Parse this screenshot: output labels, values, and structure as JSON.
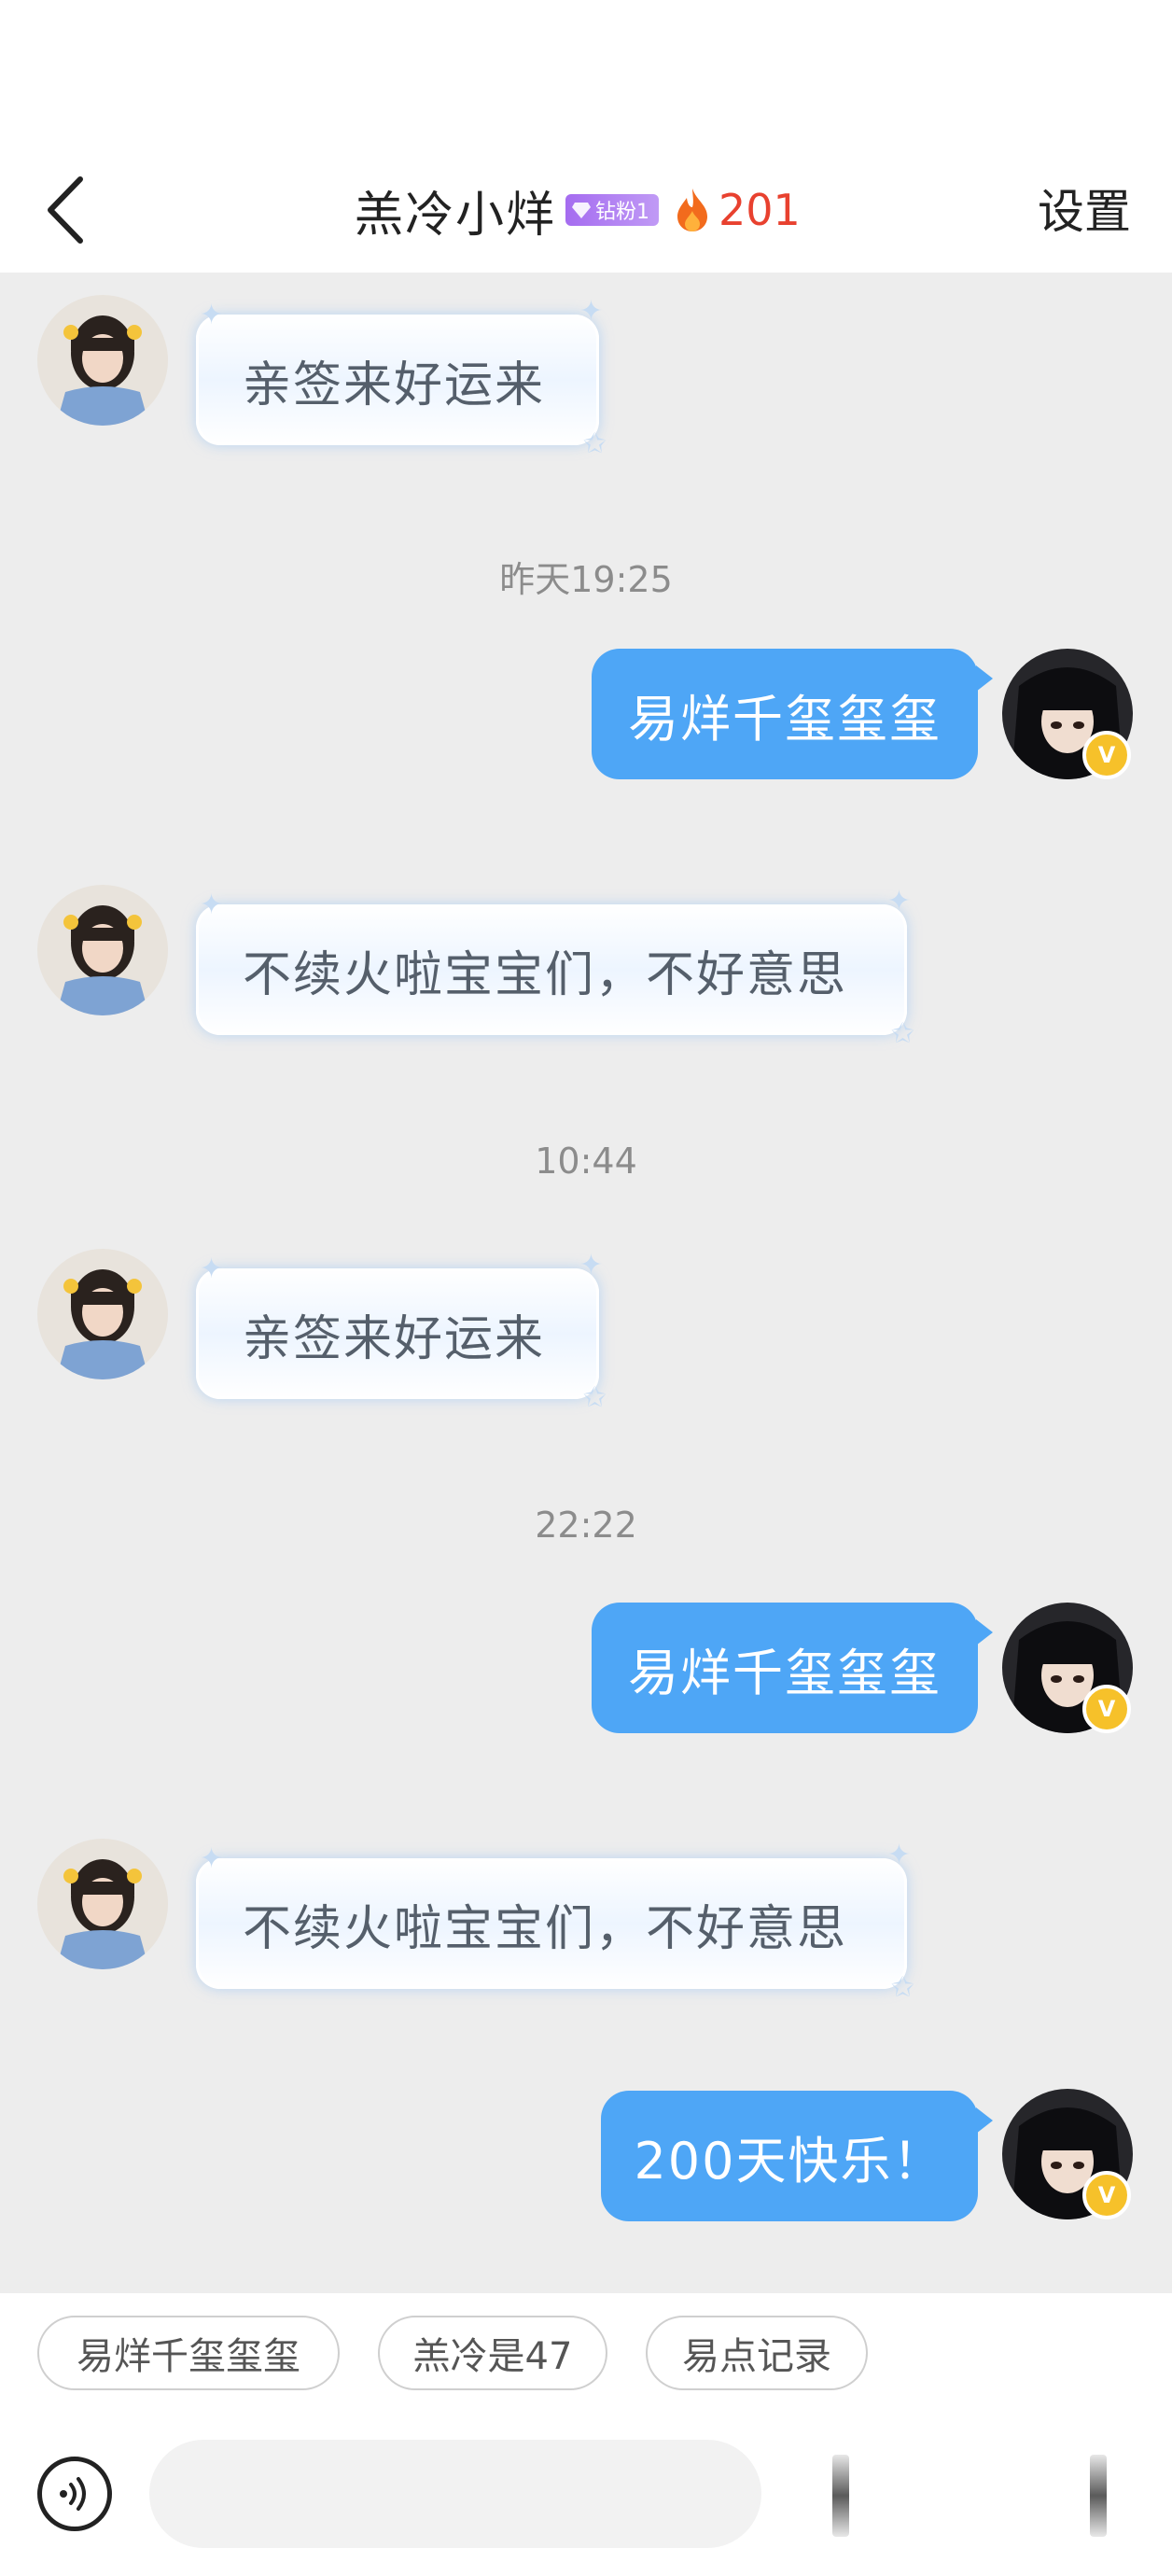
{
  "header": {
    "title": "羔冷小烊",
    "fan_badge": "钻粉1",
    "streak_count": "201",
    "settings_label": "设置"
  },
  "messages": [
    {
      "side": "left",
      "text": "亲签来好运来"
    },
    {
      "timestamp": "昨天19:25"
    },
    {
      "side": "right",
      "text": "易烊千玺玺玺"
    },
    {
      "side": "left",
      "text": "不续火啦宝宝们，不好意思"
    },
    {
      "timestamp": "10:44"
    },
    {
      "side": "left",
      "text": "亲签来好运来"
    },
    {
      "timestamp": "22:22"
    },
    {
      "side": "right",
      "text": "易烊千玺玺玺"
    },
    {
      "side": "left",
      "text": "不续火啦宝宝们，不好意思"
    },
    {
      "side": "right",
      "text": "200天快乐！"
    }
  ],
  "suggestions": [
    "易烊千玺玺玺",
    "羔冷是47",
    "易点记录"
  ],
  "input": {
    "placeholder": ""
  },
  "colors": {
    "my_bubble": "#4ea6f6",
    "chat_bg": "#ededed",
    "streak": "#e8412f",
    "badge": "#a56cf0"
  }
}
